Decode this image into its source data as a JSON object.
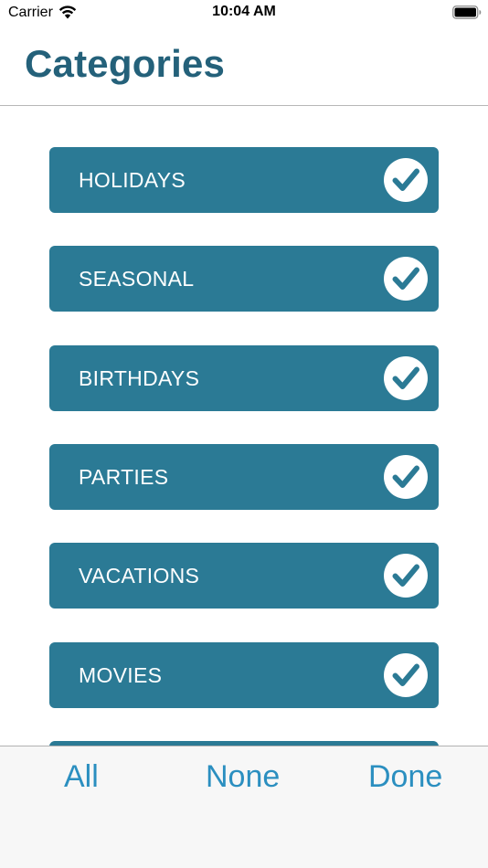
{
  "status_bar": {
    "carrier": "Carrier",
    "time": "10:04 AM",
    "wifi_icon": "wifi-icon",
    "battery_icon": "battery-full-icon"
  },
  "header": {
    "title": "Categories"
  },
  "categories": [
    {
      "label": "HOLIDAYS",
      "checked": true
    },
    {
      "label": "SEASONAL",
      "checked": true
    },
    {
      "label": "BIRTHDAYS",
      "checked": true
    },
    {
      "label": "PARTIES",
      "checked": true
    },
    {
      "label": "VACATIONS",
      "checked": true
    },
    {
      "label": "MOVIES",
      "checked": true
    },
    {
      "label": "",
      "checked": true
    }
  ],
  "toolbar": {
    "all_label": "All",
    "none_label": "None",
    "done_label": "Done"
  },
  "colors": {
    "title": "#24617a",
    "row_background": "#2b7a95",
    "check_fill": "#ffffff",
    "toolbar_text": "#2b8fc0",
    "toolbar_background": "#f7f7f7"
  }
}
